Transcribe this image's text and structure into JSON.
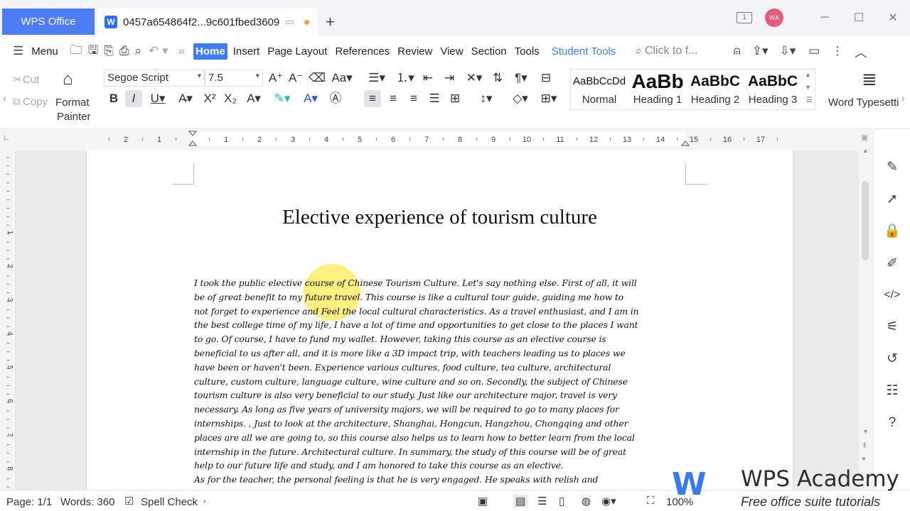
{
  "titlebar": {
    "app_tab": "WPS Office",
    "doc_tab": "0457a654864f2...9c601fbed3609",
    "doc_icon": "W",
    "window_count": "1",
    "avatar_initials": "WA",
    "minimize": "─",
    "maximize": "☐",
    "close": "✕",
    "new_tab": "+"
  },
  "menubar": {
    "menu_label": "Menu",
    "tabs": [
      "Home",
      "Insert",
      "Page Layout",
      "References",
      "Review",
      "View",
      "Section",
      "Tools",
      "Student Tools"
    ],
    "search_placeholder": "Click to f..."
  },
  "ribbon": {
    "cut": "Cut",
    "copy": "Copy",
    "format_painter_line1": "Format",
    "format_painter_line2": "Painter",
    "font_name": "Segoe Script",
    "font_size": "7.5",
    "styles": [
      {
        "preview": "AaBbCcDd",
        "label": "Normal"
      },
      {
        "preview": "AaBb",
        "label": "Heading 1"
      },
      {
        "preview": "AaBbC",
        "label": "Heading 2"
      },
      {
        "preview": "AaBbC",
        "label": "Heading 3"
      }
    ],
    "word_typesetting": "Word Typesetti"
  },
  "ruler": {
    "numbers": [
      "2",
      "1",
      "1",
      "2",
      "3",
      "4",
      "5",
      "6",
      "7",
      "8",
      "9",
      "10",
      "11",
      "12",
      "13",
      "14",
      "15",
      "16",
      "17"
    ]
  },
  "vruler": {
    "numbers": [
      "1",
      "2",
      "3",
      "4",
      "5",
      "6",
      "7",
      "8",
      "9"
    ]
  },
  "document": {
    "title": "Elective experience of tourism culture",
    "lines": [
      "I took the public elective course of Chinese Tourism Culture. Let's say nothing else. First of all, it will",
      "be of great benefit to my future travel. This course is like a cultural tour guide, guiding me how to",
      "not forget to experience and Feel the local cultural characteristics. As a travel enthusiast, and I am in",
      "the best college time of my life, I have a lot of time and opportunities to get close to the places I want",
      "to go. Of course, I have to fund my wallet. However, taking this course as an elective course is",
      "beneficial to us after all, and it is more like a 3D impact trip, with teachers leading us to places we",
      "have been or haven't been. Experience various cultures, food culture, tea culture, architectural",
      "culture, custom culture, language culture, wine culture and so on. Secondly, the subject of Chinese",
      "tourism culture is also very beneficial to our study. Just like our architecture major, travel is very",
      "necessary. As long as five years of university majors, we will be required to go to many places for",
      "internships. , Just to look at the architecture, Shanghai, Hongcun, Hangzhou, Chongqing and other",
      "places are all we are going to, so this course also helps us to learn how to better learn from the local",
      "internship in the future. Architectural culture. In summary, the study of this course will be of great",
      "help to our future life and study, and I am honored to take this course as an elective.",
      "As for the teacher, the personal feeling is that he is very engaged. He speaks with relish and"
    ]
  },
  "statusbar": {
    "page": "Page: 1/1",
    "words": "Words: 360",
    "spell_check": "Spell Check",
    "zoom": "100%"
  },
  "watermark": {
    "title": "WPS Academy",
    "subtitle": "Free office suite tutorials"
  },
  "colors": {
    "accent": "#3f7cf3",
    "app_tab": "#4d7cf4",
    "highlight": "#f5e02a"
  }
}
